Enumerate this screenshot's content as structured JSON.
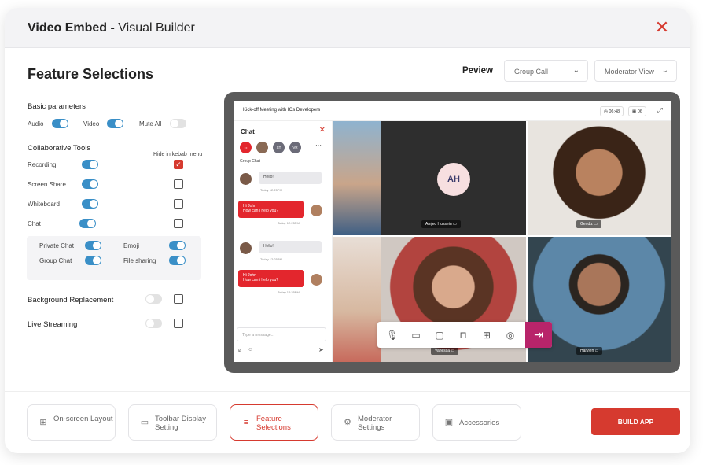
{
  "header": {
    "title_bold": "Video Embed -",
    "title_rest": " Visual Builder",
    "close_icon": "close-icon"
  },
  "section_title": "Feature Selections",
  "basic": {
    "title": "Basic parameters",
    "items": [
      {
        "label": "Audio",
        "on": true
      },
      {
        "label": "Video",
        "on": true
      },
      {
        "label": "Mute All",
        "on": false
      }
    ]
  },
  "collab": {
    "title": "Collaborative Tools",
    "hide_label": "Hide in kebab menu",
    "items": [
      {
        "label": "Recording",
        "on": true,
        "hidden": true
      },
      {
        "label": "Screen Share",
        "on": true,
        "hidden": false
      },
      {
        "label": "Whiteboard",
        "on": true,
        "hidden": false
      },
      {
        "label": "Chat",
        "on": true,
        "hidden": false
      }
    ],
    "chat_options": [
      {
        "label": "Private Chat",
        "on": true
      },
      {
        "label": "Emoji",
        "on": true
      },
      {
        "label": "Group Chat",
        "on": true
      },
      {
        "label": "File sharing",
        "on": true
      }
    ]
  },
  "extras": [
    {
      "label": "Background Replacement",
      "on": false,
      "checked": false
    },
    {
      "label": "Live Streaming",
      "on": false,
      "checked": false
    }
  ],
  "preview": {
    "label": "Peview",
    "dropdown_call": "Group Call",
    "dropdown_view": "Moderator View"
  },
  "meeting": {
    "title": "Kick-off Meeting with IOs Developers",
    "timer": "06:48",
    "count": "06",
    "chat": {
      "title": "Chat",
      "group_label": "Group Chat",
      "avatars": [
        "ST",
        "VR"
      ],
      "messages": [
        {
          "text": "Hello!",
          "time": "Today 12:25PM",
          "dir": "in"
        },
        {
          "text": "Hi John\nHow can i help you?",
          "time": "Today 12:25PM",
          "dir": "out"
        },
        {
          "text": "Hello!",
          "time": "Today 12:25PM",
          "dir": "in"
        },
        {
          "text": "Hi John\nHow can i help you?",
          "time": "Today 12:25PM",
          "dir": "out"
        }
      ],
      "input_placeholder": "Type a message..."
    },
    "participants": [
      {
        "initials": "AH",
        "name": "Amjed Hussein"
      },
      {
        "name": "Gendiz"
      },
      {
        "name": "Vanessa"
      },
      {
        "name": "Harylen"
      }
    ]
  },
  "tabs": [
    {
      "label": "On-screen Layout",
      "icon": "grid-icon",
      "active": false
    },
    {
      "label": "Toolbar Display Setting",
      "icon": "monitor-icon",
      "active": false
    },
    {
      "label": "Feature Selections",
      "icon": "list-check-icon",
      "active": true
    },
    {
      "label": "Moderator Settings",
      "icon": "gear-icon",
      "active": false
    },
    {
      "label": "Accessories",
      "icon": "accessories-icon",
      "active": false
    }
  ],
  "build_label": "BUILD APP",
  "colors": {
    "accent": "#d63a2f",
    "toggle_on": "#3a8fc7",
    "chat_red": "#e3262d",
    "leave": "#b8246a"
  }
}
